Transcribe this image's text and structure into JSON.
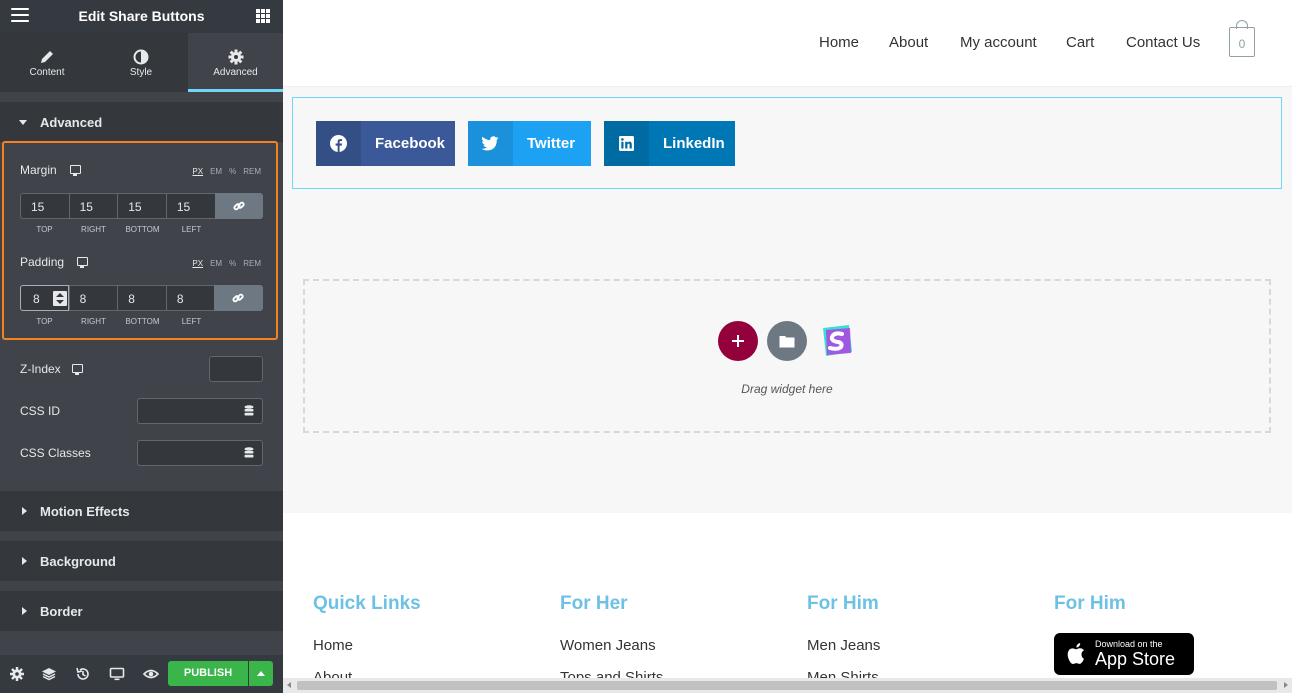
{
  "panel": {
    "title": "Edit Share Buttons",
    "tabs": [
      "Content",
      "Style",
      "Advanced"
    ],
    "active_tab": "Advanced",
    "section_advanced": "Advanced",
    "margin": {
      "label": "Margin",
      "units": [
        "PX",
        "EM",
        "%",
        "REM"
      ],
      "selected_unit": "PX",
      "values": [
        "15",
        "15",
        "15",
        "15"
      ],
      "sides": [
        "TOP",
        "RIGHT",
        "BOTTOM",
        "LEFT"
      ]
    },
    "padding": {
      "label": "Padding",
      "units": [
        "PX",
        "EM",
        "%",
        "REM"
      ],
      "selected_unit": "PX",
      "values": [
        "8",
        "8",
        "8",
        "8"
      ],
      "sides": [
        "TOP",
        "RIGHT",
        "BOTTOM",
        "LEFT"
      ]
    },
    "z_index": {
      "label": "Z-Index",
      "value": ""
    },
    "css_id": {
      "label": "CSS ID",
      "value": ""
    },
    "css_classes": {
      "label": "CSS Classes",
      "value": ""
    },
    "sections": [
      "Motion Effects",
      "Background",
      "Border"
    ],
    "publish_label": "PUBLISH",
    "accent_color": "#f4821f"
  },
  "site": {
    "nav": [
      "Home",
      "About",
      "My account",
      "Cart",
      "Contact Us"
    ],
    "cart_count": "0",
    "share_buttons": [
      {
        "label": "Facebook",
        "icon": "facebook-icon",
        "color": "#3b5998"
      },
      {
        "label": "Twitter",
        "icon": "twitter-icon",
        "color": "#1da1f2"
      },
      {
        "label": "LinkedIn",
        "icon": "linkedin-icon",
        "color": "#0077b5"
      }
    ],
    "drag_text": "Drag widget here",
    "footer": {
      "columns": [
        {
          "title": "Quick Links",
          "links": [
            "Home",
            "About"
          ]
        },
        {
          "title": "For Her",
          "links": [
            "Women Jeans",
            "Tops and Shirts"
          ]
        },
        {
          "title": "For Him",
          "links": [
            "Men Jeans",
            "Men Shirts"
          ]
        },
        {
          "title": "For Him",
          "links": []
        }
      ],
      "app_store": {
        "small": "Download on the",
        "big": "App Store"
      }
    }
  }
}
